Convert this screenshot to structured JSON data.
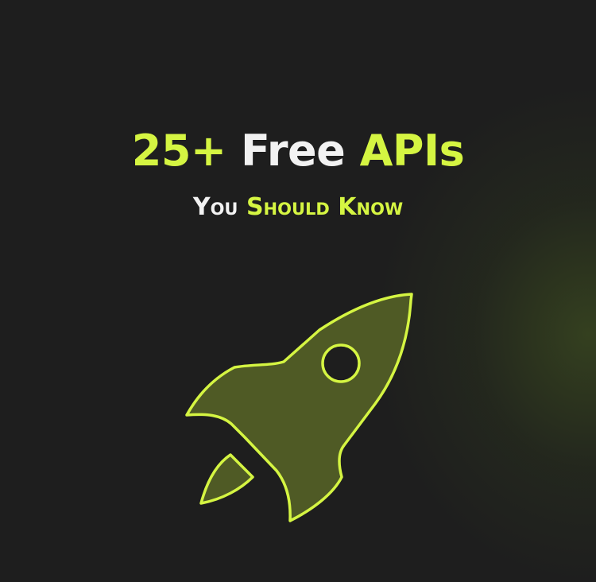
{
  "headline": {
    "part1": "25+",
    "part2": "Free",
    "part3": "APIs"
  },
  "subline": {
    "part1": "You",
    "part2": "Should Know"
  },
  "icon": "rocket-icon",
  "colors": {
    "background": "#1e1e1e",
    "accent": "#d5f542",
    "light_text": "#f2f2f2",
    "rocket_fill": "#4f5a25",
    "glow": "#3d4f20"
  }
}
